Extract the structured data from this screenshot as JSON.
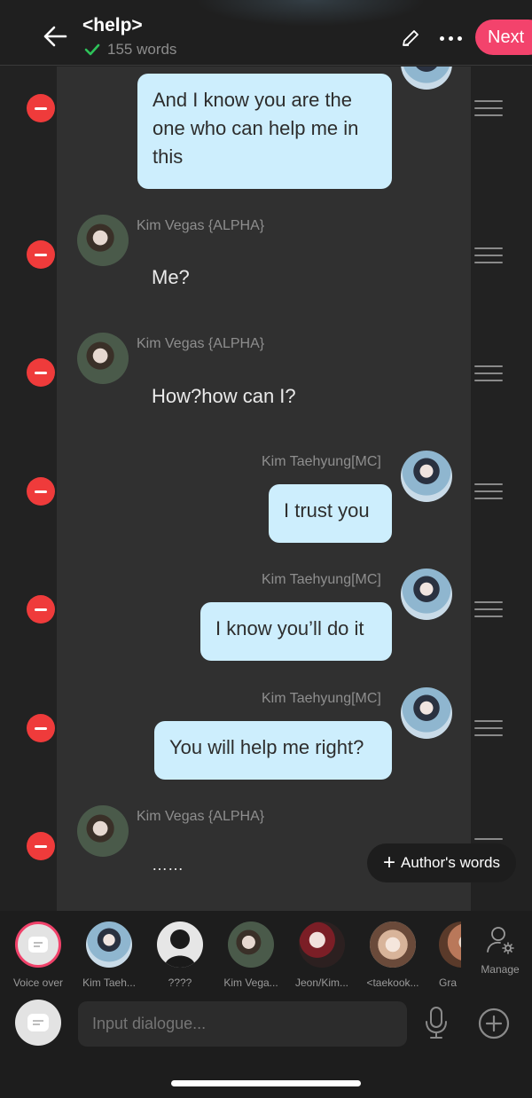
{
  "header": {
    "title": "<help>",
    "word_count": "155 words",
    "next_label": "Next",
    "accent_color": "#f3436c"
  },
  "messages": [
    {
      "type": "self",
      "text": "And I know you are the one who can help me in this"
    },
    {
      "type": "other",
      "speaker": "Kim Vegas {ALPHA}",
      "text": "Me?"
    },
    {
      "type": "other",
      "speaker": "Kim Vegas {ALPHA}",
      "text": "How?how can I?"
    },
    {
      "type": "self",
      "speaker": "Kim Taehyung[MC]",
      "text": "I trust you"
    },
    {
      "type": "self",
      "speaker": "Kim Taehyung[MC]",
      "text": "I know you’ll do it"
    },
    {
      "type": "self",
      "speaker": "Kim Taehyung[MC]",
      "text": "You will help me right?"
    },
    {
      "type": "other",
      "speaker": "Kim Vegas {ALPHA}",
      "text": "……"
    }
  ],
  "authors_words_label": "Author's words",
  "characters": [
    {
      "name": "Voice over",
      "icon": "voice-over-icon"
    },
    {
      "name": "Kim Taeh..."
    },
    {
      "name": "????"
    },
    {
      "name": "Kim Vega..."
    },
    {
      "name": "Jeon/Kim..."
    },
    {
      "name": "<taekook..."
    },
    {
      "name": "Gra"
    }
  ],
  "manage_label": "Manage",
  "input": {
    "placeholder": "Input dialogue..."
  },
  "colors": {
    "bubble": "#cdeefd",
    "delete": "#ef3b3b",
    "panel": "#303030"
  }
}
